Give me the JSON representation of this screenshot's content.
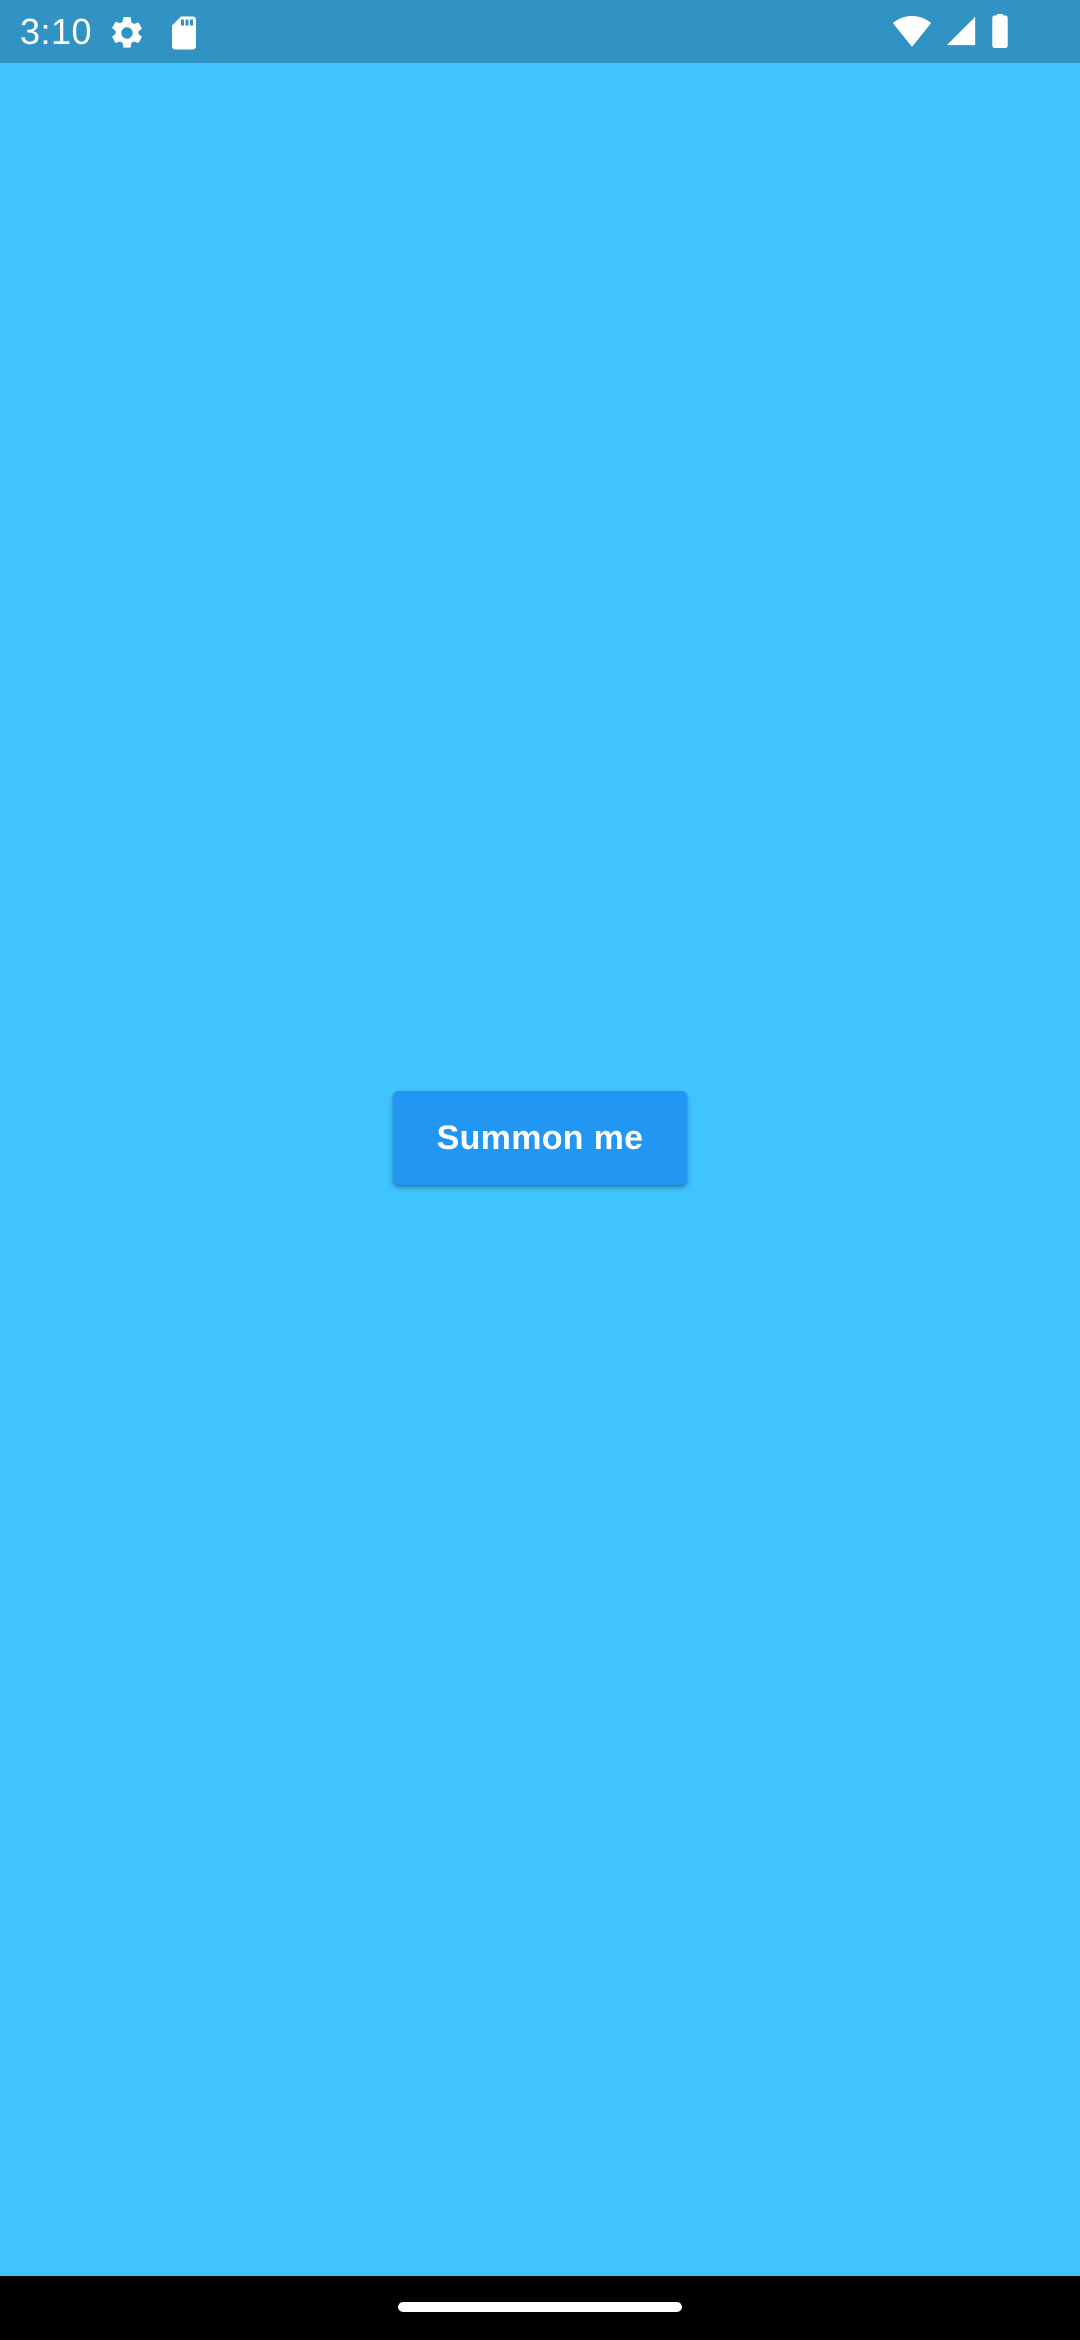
{
  "status_bar": {
    "time": "3:10",
    "left_icons": [
      "settings-icon",
      "sd-card-icon"
    ],
    "right_icons": [
      "wifi-icon",
      "signal-icon",
      "battery-icon"
    ],
    "background": "#3192C4"
  },
  "main": {
    "background": "#40C4FF",
    "button": {
      "label": "Summon me",
      "color": "#2196F3"
    }
  },
  "nav_bar": {
    "background": "#000000",
    "handle": "home-gesture-handle"
  }
}
